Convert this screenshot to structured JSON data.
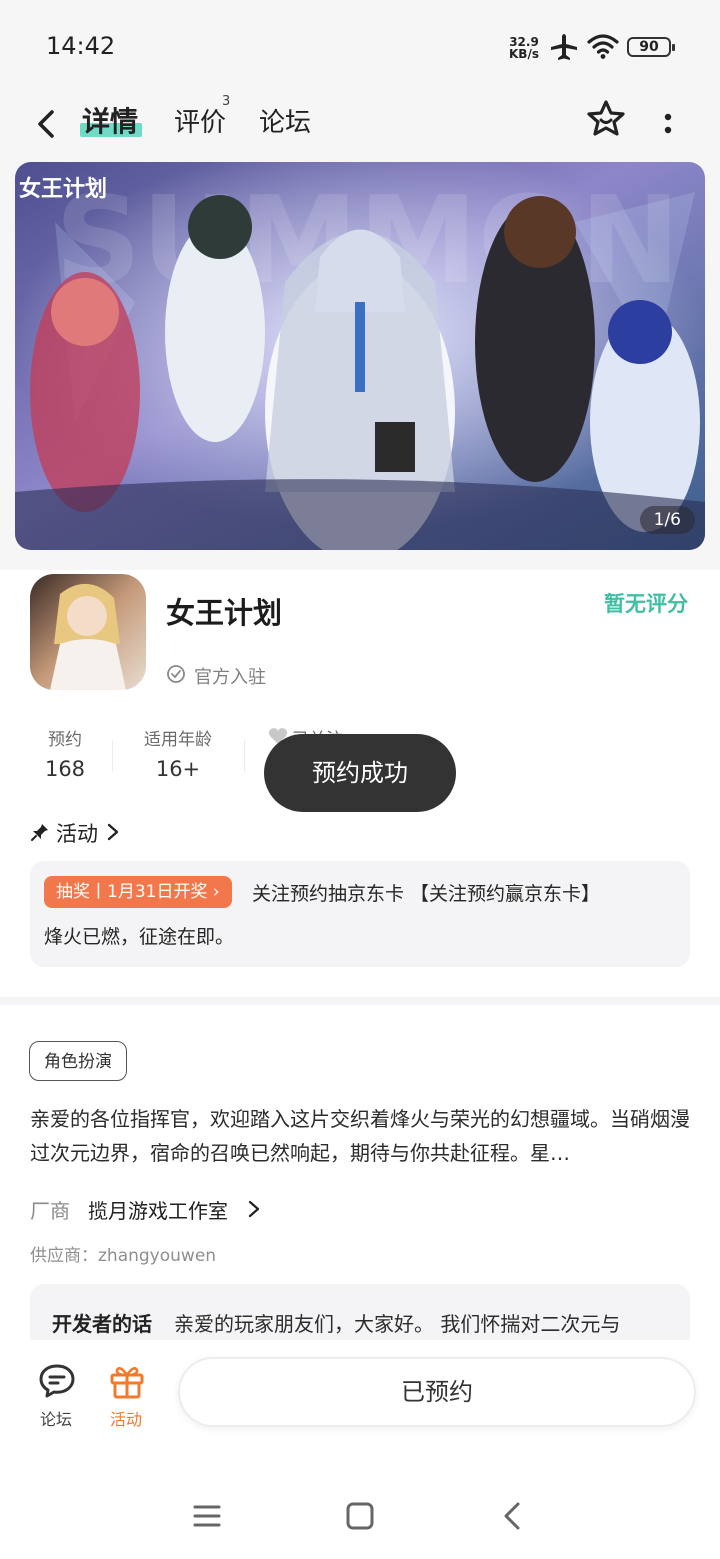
{
  "status_bar": {
    "time": "14:42",
    "net_speed_value": "32.9",
    "net_speed_unit": "KB/s",
    "battery": "90"
  },
  "header": {
    "tabs": [
      {
        "label": "详情",
        "active": true
      },
      {
        "label": "评价",
        "badge": "3"
      },
      {
        "label": "论坛"
      }
    ]
  },
  "banner": {
    "logo_text": "女王计划",
    "counter": "1/6"
  },
  "game": {
    "title": "女王计划",
    "rating": "暂无评分",
    "official": "官方入驻"
  },
  "stats": [
    {
      "label": "预约",
      "value": "168"
    },
    {
      "label": "适用年龄",
      "value": "16+"
    },
    {
      "label": "已关注"
    }
  ],
  "toast": "预约成功",
  "activity": {
    "title": "活动",
    "badge": "抽奖丨1月31日开奖",
    "text_line1": "关注预约抽京东卡 【关注预约赢京东卡】",
    "text_line2": "烽火已燃，征途在即。"
  },
  "detail": {
    "genre": "角色扮演",
    "description": "亲爱的各位指挥官，欢迎踏入这片交织着烽火与荣光的幻想疆域。当硝烟漫过次元边界，宿命的召唤已然响起，期待与你共赴征程。星…",
    "vendor_label": "厂商",
    "vendor_name": "揽月游戏工作室",
    "supplier": "供应商：zhangyouwen",
    "dev_title": "开发者的话",
    "dev_text": "亲爱的玩家朋友们，大家好。 我们怀揣对二次元与"
  },
  "bottom_bar": {
    "forum_label": "论坛",
    "event_label": "活动",
    "reserve_button": "已预约"
  },
  "colors": {
    "accent_teal": "#6fdbc7",
    "rating_teal": "#3fbfa4",
    "lottery_orange": "#f2784b",
    "event_orange": "#f07a2d"
  }
}
